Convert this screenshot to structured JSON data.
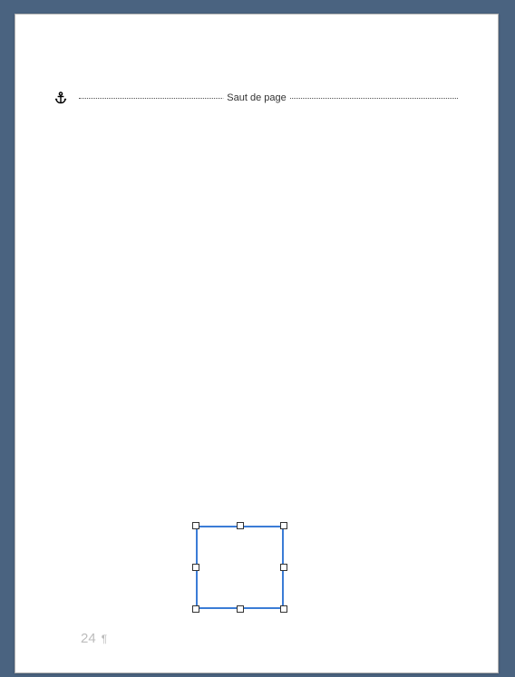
{
  "page_break": {
    "label": "Saut de page"
  },
  "anchor": {
    "icon_name": "anchor-icon"
  },
  "selected_shape": {
    "type": "rectangle",
    "border_color": "#3b7cd6",
    "handles": 8
  },
  "footer": {
    "page_number": "24",
    "formatting_mark": "¶"
  },
  "colors": {
    "app_background": "#4a6380",
    "page_background": "#ffffff",
    "selection_blue": "#3b7cd6",
    "footer_grey": "#bcbcbc"
  }
}
